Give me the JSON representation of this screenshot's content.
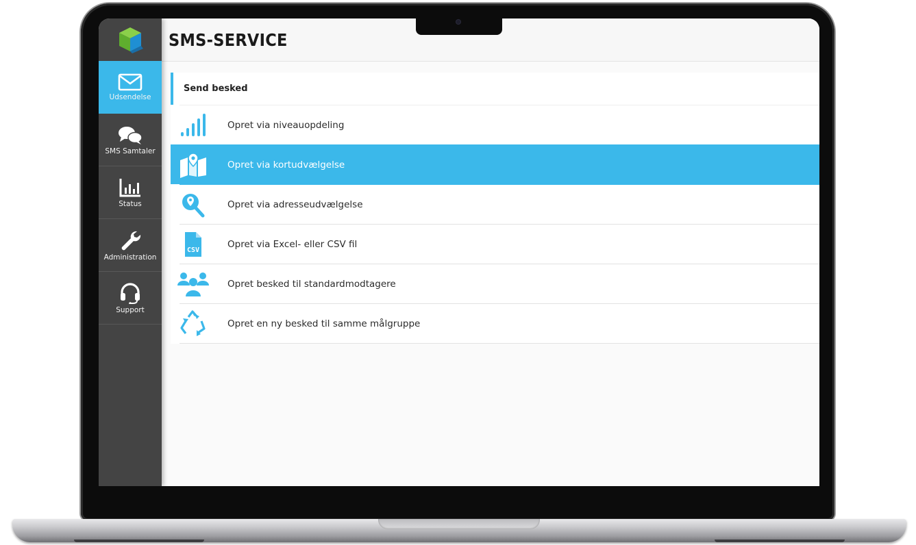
{
  "app": {
    "title": "SMS-SERVICE"
  },
  "colors": {
    "accent": "#3bb8ea",
    "sidebar": "#444444",
    "logo_green": "#7cc242",
    "logo_blue": "#1e88c8"
  },
  "sidebar": {
    "items": [
      {
        "label": "Udsendelse",
        "icon": "envelope-icon",
        "active": true
      },
      {
        "label": "SMS Samtaler",
        "icon": "chat-bubbles-icon",
        "active": false
      },
      {
        "label": "Status",
        "icon": "bar-chart-icon",
        "active": false
      },
      {
        "label": "Administration",
        "icon": "wrench-icon",
        "active": false
      },
      {
        "label": "Support",
        "icon": "headset-icon",
        "active": false
      }
    ]
  },
  "main": {
    "section_title": "Send besked",
    "items": [
      {
        "label": "Opret via niveauopdeling",
        "icon": "signal-bars-icon",
        "selected": false
      },
      {
        "label": "Opret via kortudvælgelse",
        "icon": "map-pin-icon",
        "selected": true
      },
      {
        "label": "Opret via adresseudvælgelse",
        "icon": "magnifier-location-icon",
        "selected": false
      },
      {
        "label": "Opret via Excel- eller CSV fil",
        "icon": "csv-file-icon",
        "icon_text": "CSV",
        "selected": false
      },
      {
        "label": "Opret besked til standardmodtagere",
        "icon": "people-group-icon",
        "selected": false
      },
      {
        "label": "Opret en ny besked til samme målgruppe",
        "icon": "recycle-icon",
        "selected": false
      }
    ]
  }
}
